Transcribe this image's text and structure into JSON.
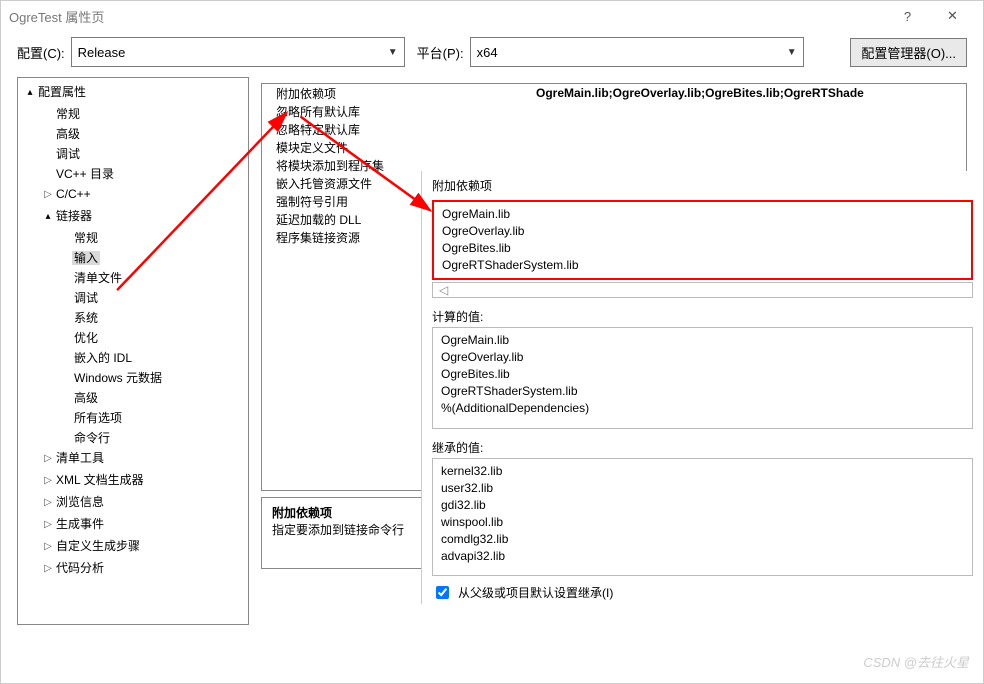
{
  "title": "OgreTest 属性页",
  "config_row": {
    "config_label": "配置(C):",
    "config_value": "Release",
    "platform_label": "平台(P):",
    "platform_value": "x64",
    "manager_button": "配置管理器(O)..."
  },
  "tree": {
    "root": "配置属性",
    "items": [
      "常规",
      "高级",
      "调试",
      "VC++ 目录"
    ],
    "ccpp": "C/C++",
    "linker": "链接器",
    "linker_children": [
      "常规",
      "输入",
      "清单文件",
      "调试",
      "系统",
      "优化",
      "嵌入的 IDL",
      "Windows 元数据",
      "高级",
      "所有选项",
      "命令行"
    ],
    "rest": [
      "清单工具",
      "XML 文档生成器",
      "浏览信息",
      "生成事件",
      "自定义生成步骤",
      "代码分析"
    ]
  },
  "props": {
    "rows": [
      {
        "k": "附加依赖项",
        "v": "OgreMain.lib;OgreOverlay.lib;OgreBites.lib;OgreRTShade"
      },
      {
        "k": "忽略所有默认库",
        "v": ""
      },
      {
        "k": "忽略特定默认库",
        "v": ""
      },
      {
        "k": "模块定义文件",
        "v": ""
      },
      {
        "k": "将模块添加到程序集",
        "v": ""
      },
      {
        "k": "嵌入托管资源文件",
        "v": ""
      },
      {
        "k": "强制符号引用",
        "v": ""
      },
      {
        "k": "延迟加载的 DLL",
        "v": ""
      },
      {
        "k": "程序集链接资源",
        "v": ""
      }
    ]
  },
  "desc": {
    "t": "附加依赖项",
    "b": "指定要添加到链接命令行"
  },
  "popup": {
    "title": "附加依赖项",
    "edit_lines": [
      "OgreMain.lib",
      "OgreOverlay.lib",
      "OgreBites.lib",
      "OgreRTShaderSystem.lib"
    ],
    "left_arrow": "◁",
    "calc_label": "计算的值:",
    "calc_lines": [
      "OgreMain.lib",
      "OgreOverlay.lib",
      "OgreBites.lib",
      "OgreRTShaderSystem.lib",
      "%(AdditionalDependencies)"
    ],
    "inh_label": "继承的值:",
    "inh_lines": [
      "kernel32.lib",
      "user32.lib",
      "gdi32.lib",
      "winspool.lib",
      "comdlg32.lib",
      "advapi32.lib"
    ],
    "inherit_chk": "从父级或项目默认设置继承(I)"
  },
  "watermark": "CSDN @去往火星"
}
